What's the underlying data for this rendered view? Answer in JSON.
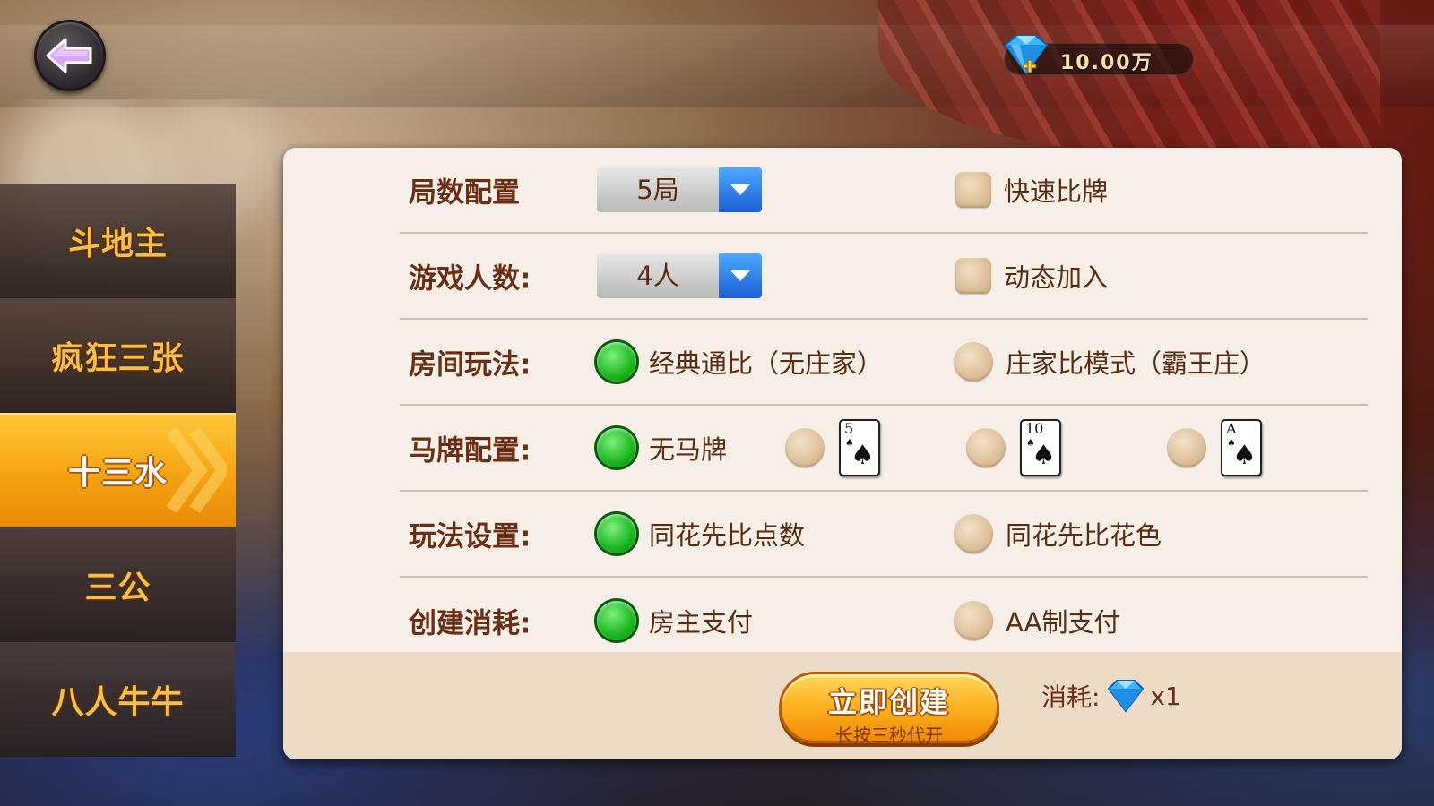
{
  "header": {
    "currency": {
      "icon": "diamond-plus-icon",
      "value": "10.00万"
    }
  },
  "sidebar": {
    "tabs": [
      {
        "label": "斗地主",
        "active": false
      },
      {
        "label": "疯狂三张",
        "active": false
      },
      {
        "label": "十三水",
        "active": true
      },
      {
        "label": "三公",
        "active": false
      },
      {
        "label": "八人牛牛",
        "active": false
      }
    ]
  },
  "settings": {
    "rounds": {
      "label": "局数配置",
      "dropdown_value": "5局",
      "checkbox_label": "快速比牌",
      "checkbox_checked": false
    },
    "players": {
      "label": "游戏人数:",
      "dropdown_value": "4人",
      "checkbox_label": "动态加入",
      "checkbox_checked": false
    },
    "room_mode": {
      "label": "房间玩法:",
      "options": [
        {
          "label": "经典通比（无庄家）",
          "selected": true
        },
        {
          "label": "庄家比模式（霸王庄）",
          "selected": false
        }
      ]
    },
    "horse_card": {
      "label": "马牌配置:",
      "options": [
        {
          "label": "无马牌",
          "selected": true
        },
        {
          "card_rank": "5",
          "card_suit": "spade",
          "selected": false
        },
        {
          "card_rank": "10",
          "card_suit": "spade",
          "selected": false
        },
        {
          "card_rank": "A",
          "card_suit": "spade",
          "selected": false
        }
      ]
    },
    "play_rule": {
      "label": "玩法设置:",
      "options": [
        {
          "label": "同花先比点数",
          "selected": true
        },
        {
          "label": "同花先比花色",
          "selected": false
        }
      ]
    },
    "create_cost": {
      "label": "创建消耗:",
      "options": [
        {
          "label": "房主支付",
          "selected": true
        },
        {
          "label": "AA制支付",
          "selected": false
        }
      ]
    }
  },
  "footer": {
    "create_button": {
      "title": "立即创建",
      "subtitle": "长按三秒代开"
    },
    "cost": {
      "label": "消耗:",
      "icon": "diamond-icon",
      "value": "x1"
    }
  },
  "colors": {
    "accent_orange": "#f5a312",
    "label_brown": "#6b2e12",
    "radio_green": "#19b51e",
    "dropdown_blue": "#1b5fd9",
    "panel_bg": "#f5efe7"
  }
}
